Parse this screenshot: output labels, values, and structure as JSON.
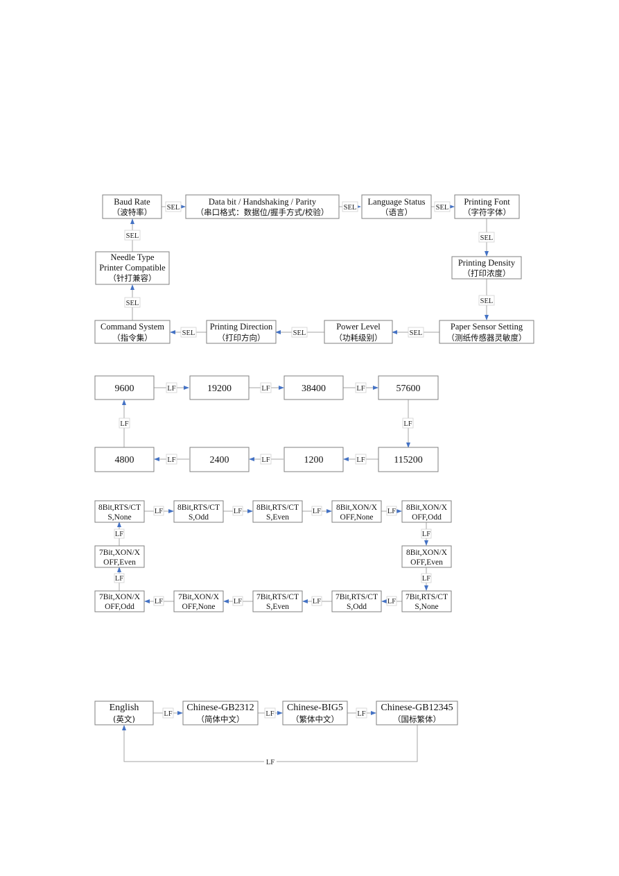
{
  "diagrams": {
    "menu": {
      "connector_label": "SEL",
      "nodes": [
        {
          "id": "baud_rate",
          "en": "Baud Rate",
          "cn": "（波特率）"
        },
        {
          "id": "data_bit",
          "en": "Data bit / Handshaking / Parity",
          "cn": "（串口格式：数据位/握手方式/校验）"
        },
        {
          "id": "language_status",
          "en": "Language Status",
          "cn": "（语言）"
        },
        {
          "id": "printing_font",
          "en": "Printing Font",
          "cn": "（字符字体）"
        },
        {
          "id": "printing_density",
          "en": "Printing Density",
          "cn": "（打印浓度）"
        },
        {
          "id": "paper_sensor",
          "en": "Paper Sensor Setting",
          "cn": "（测纸传感器灵敏度）"
        },
        {
          "id": "power_level",
          "en": "Power Level",
          "cn": "（功耗级别）"
        },
        {
          "id": "printing_direction",
          "en": "Printing Direction",
          "cn": "（打印方向）"
        },
        {
          "id": "command_system",
          "en": "Command System",
          "cn": "（指令集）"
        },
        {
          "id": "needle_type",
          "en1": "Needle Type",
          "en2": "Printer Compatible",
          "cn": "（针打兼容）"
        }
      ]
    },
    "baud": {
      "connector_label": "LF",
      "nodes": [
        "9600",
        "19200",
        "38400",
        "57600",
        "115200",
        "1200",
        "2400",
        "4800"
      ]
    },
    "format": {
      "connector_label": "LF",
      "nodes": [
        {
          "l1": "8Bit,RTS/CT",
          "l2": "S,None"
        },
        {
          "l1": "8Bit,RTS/CT",
          "l2": "S,Odd"
        },
        {
          "l1": "8Bit,RTS/CT",
          "l2": "S,Even"
        },
        {
          "l1": "8Bit,XON/X",
          "l2": "OFF,None"
        },
        {
          "l1": "8Bit,XON/X",
          "l2": "OFF,Odd"
        },
        {
          "l1": "8Bit,XON/X",
          "l2": "OFF,Even"
        },
        {
          "l1": "7Bit,RTS/CT",
          "l2": "S,None"
        },
        {
          "l1": "7Bit,RTS/CT",
          "l2": "S,Odd"
        },
        {
          "l1": "7Bit,RTS/CT",
          "l2": "S,Even"
        },
        {
          "l1": "7Bit,XON/X",
          "l2": "OFF,None"
        },
        {
          "l1": "7Bit,XON/X",
          "l2": "OFF,Odd"
        },
        {
          "l1": "7Bit,XON/X",
          "l2": "OFF,Even"
        }
      ]
    },
    "language": {
      "connector_label": "LF",
      "nodes": [
        {
          "en": "English",
          "cn": "(英文)"
        },
        {
          "en": "Chinese-GB2312",
          "cn": "（简体中文）"
        },
        {
          "en": "Chinese-BIG5",
          "cn": "（繁体中文）"
        },
        {
          "en": "Chinese-GB12345",
          "cn": "（国标繁体）"
        }
      ]
    }
  },
  "colors": {
    "arrow": "#4472c4",
    "box_border": "#7f7f7f",
    "line": "#a6a6a6"
  }
}
